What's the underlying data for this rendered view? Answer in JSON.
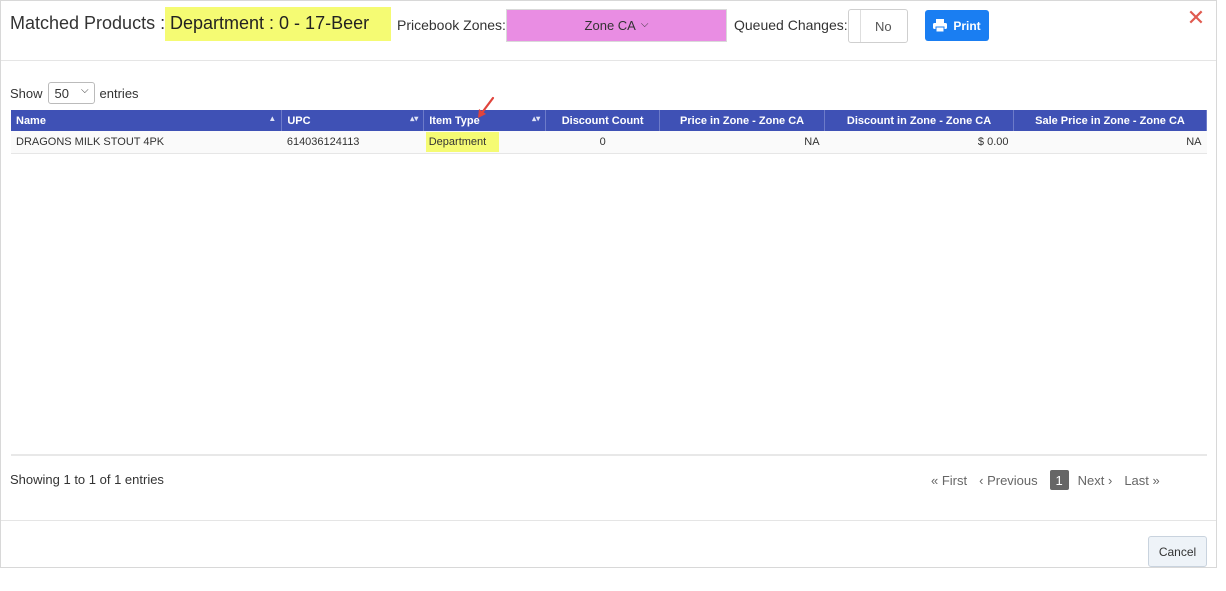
{
  "header": {
    "title_label": "Matched Products :",
    "title_value": "Department : 0 - 17-Beer",
    "pricebook_label": "Pricebook Zones:",
    "zone_selected": "Zone CA",
    "queued_label": "Queued Changes:",
    "queued_value": "No",
    "print_label": "Print",
    "close_label": "✕"
  },
  "colors": {
    "title_highlight": "#f5fb73",
    "zone_highlight": "#e98de3",
    "table_header": "#3f51b5",
    "print_button": "#1a7ef2",
    "close": "#e05a4f",
    "arrow": "#e0443c"
  },
  "length": {
    "show_label": "Show",
    "value": "50",
    "entries_label": "entries"
  },
  "table": {
    "columns": [
      "Name",
      "UPC",
      "Item Type",
      "Discount Count",
      "Price in Zone - Zone CA",
      "Discount in Zone - Zone CA",
      "Sale Price in Zone - Zone CA"
    ],
    "rows": [
      {
        "name": "DRAGONS MILK STOUT 4PK",
        "upc": "614036124113",
        "item_type": "Department",
        "discount_count": "0",
        "price_in_zone": "NA",
        "discount_in_zone": "$ 0.00",
        "sale_price_in_zone": "NA"
      }
    ]
  },
  "footer": {
    "info": "Showing 1 to 1 of 1 entries",
    "first": "« First",
    "previous": "‹ Previous",
    "page": "1",
    "next": "Next ›",
    "last": "Last »",
    "cancel": "Cancel"
  }
}
